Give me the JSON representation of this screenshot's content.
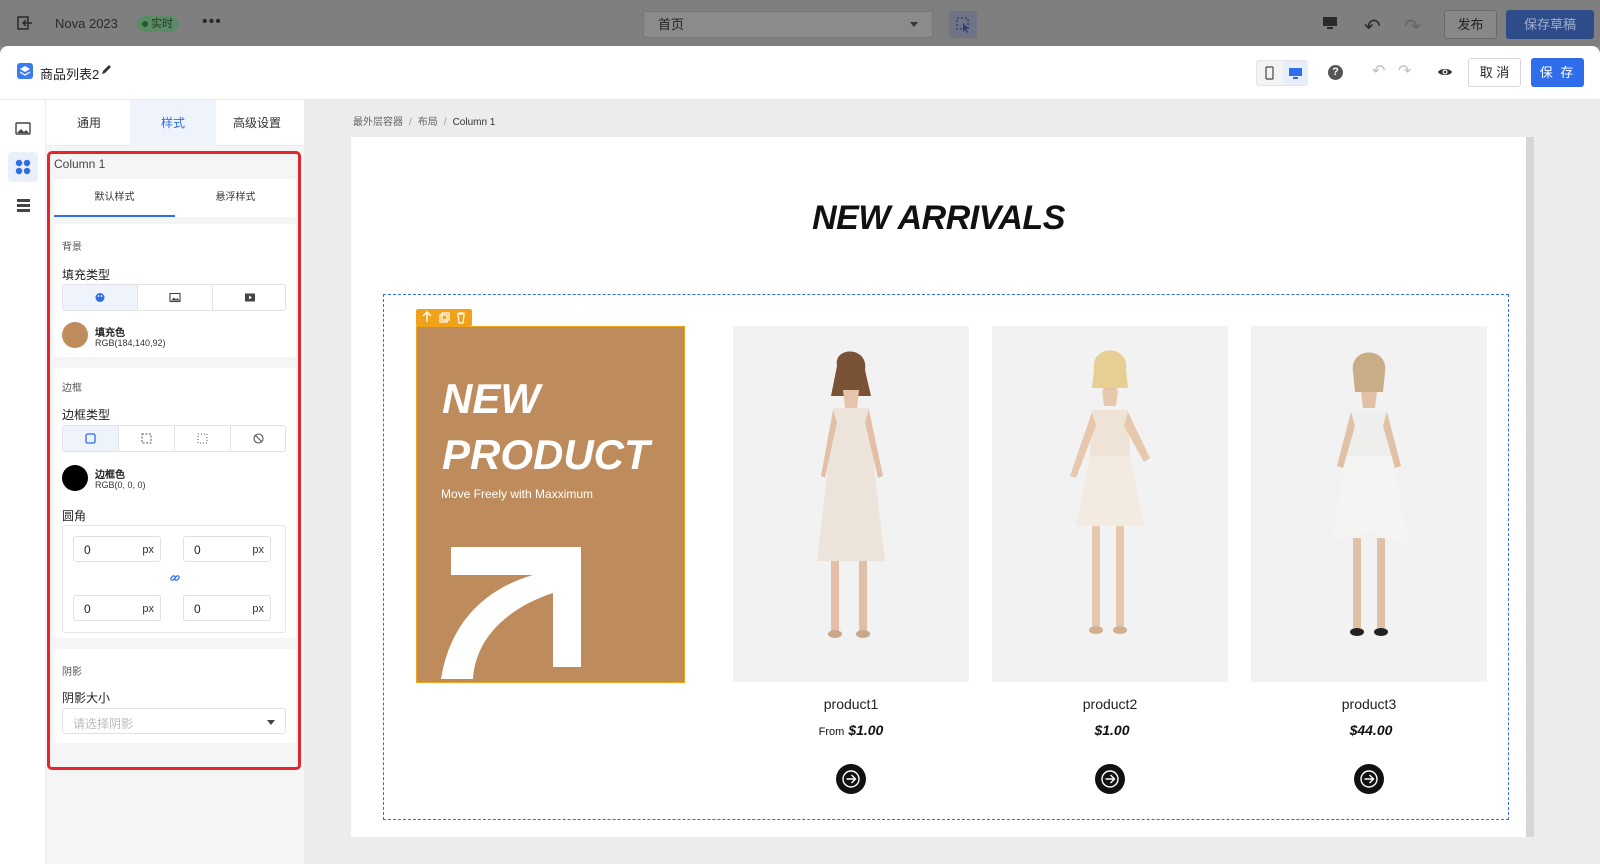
{
  "topbar": {
    "title": "Nova 2023",
    "badge": "实时",
    "more": "•••",
    "page_select": "首页",
    "publish": "发布",
    "save_draft": "保存草稿"
  },
  "editor": {
    "title": "商品列表2",
    "cancel": "取 消",
    "save": "保 存",
    "help": "?"
  },
  "panel": {
    "tabs": [
      "通用",
      "样式",
      "高级设置"
    ],
    "active_tab": "样式",
    "column_name": "Column 1",
    "sub_tabs": [
      "默认样式",
      "悬浮样式"
    ],
    "background": {
      "section": "背景",
      "fill_label": "填充类型",
      "fill_types": [
        "palette-icon",
        "image-icon",
        "video-icon"
      ],
      "color_name": "填充色",
      "color_value": "RGB(184,140,92)",
      "color_hex": "#b88c5c"
    },
    "border": {
      "section": "边框",
      "type_label": "边框类型",
      "types": [
        "solid-border-icon",
        "dashed-border-icon",
        "dotted-border-icon",
        "no-border-icon"
      ],
      "color_name": "边框色",
      "color_value": "RGB(0, 0, 0)",
      "color_hex": "#000000",
      "radius_label": "圆角",
      "radius": {
        "top_left": "0",
        "top_right": "0",
        "bottom_left": "0",
        "bottom_right": "0",
        "unit": "px"
      }
    },
    "shadow": {
      "section": "阴影",
      "size_label": "阴影大小",
      "placeholder": "请选择阴影"
    }
  },
  "canvas": {
    "breadcrumb": [
      "最外层容器",
      "布局",
      "Column 1"
    ],
    "heading": "NEW ARRIVALS",
    "banner": {
      "line1": "NEW",
      "line2": "PRODUCT",
      "subtitle": "Move Freely with Maxximum",
      "bg": "#be8c5c"
    },
    "products": [
      {
        "name": "product1",
        "prefix": "From",
        "price": "$1.00"
      },
      {
        "name": "product2",
        "prefix": "",
        "price": "$1.00"
      },
      {
        "name": "product3",
        "prefix": "",
        "price": "$44.00"
      }
    ]
  },
  "colors": {
    "accent": "#2f6dea",
    "selection_outline": "#e5242b",
    "toolbar_orange": "#f0a21a"
  }
}
